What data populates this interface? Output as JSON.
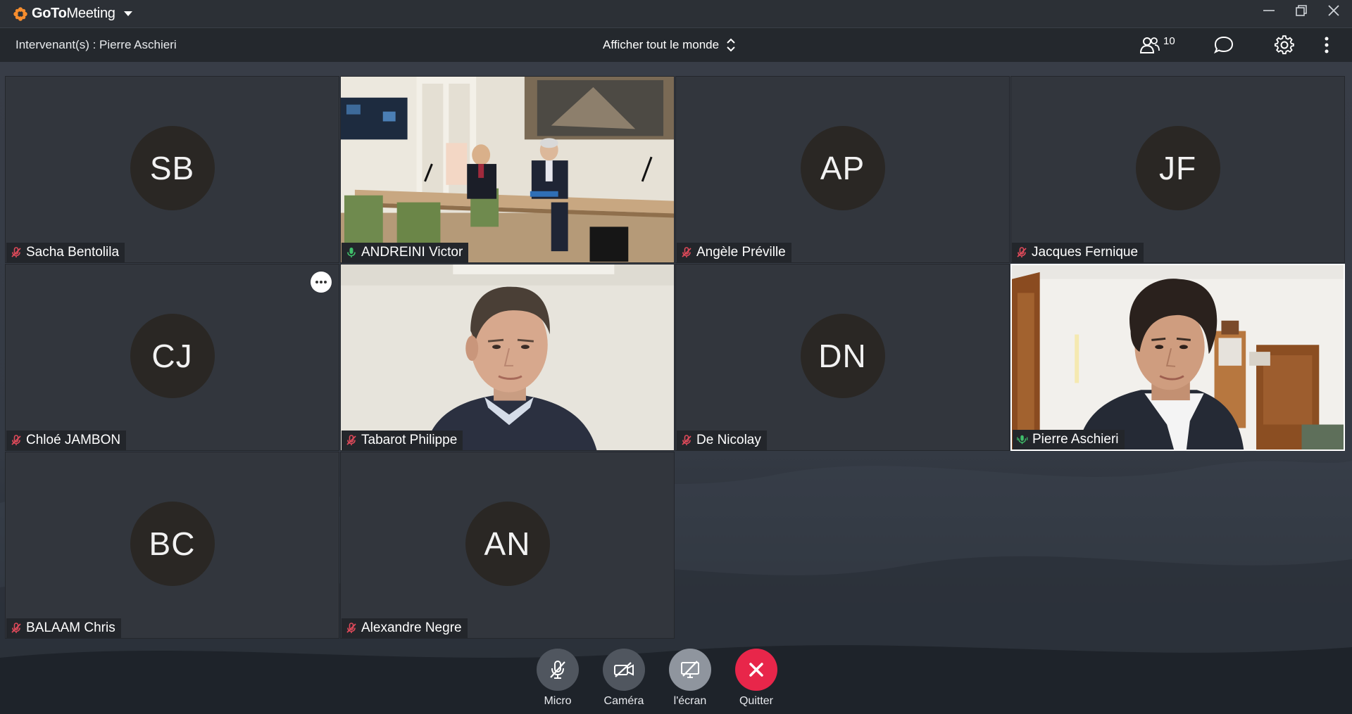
{
  "app": {
    "brand_bold": "GoTo",
    "brand_light": "Meeting"
  },
  "toolbar": {
    "speaker_label": "Intervenant(s) : Pierre Aschieri",
    "view_selector": "Afficher tout le monde",
    "participants_count": "10"
  },
  "participants": [
    {
      "name": "Sacha Bentolila",
      "initials": "SB",
      "mic": "muted"
    },
    {
      "name": "ANDREINI Victor",
      "initials": "",
      "mic": "active",
      "video": true
    },
    {
      "name": "Angèle Préville",
      "initials": "AP",
      "mic": "muted"
    },
    {
      "name": "Jacques Fernique",
      "initials": "JF",
      "mic": "muted"
    },
    {
      "name": "Chloé JAMBON",
      "initials": "CJ",
      "mic": "muted"
    },
    {
      "name": "Tabarot Philippe",
      "initials": "",
      "mic": "muted",
      "video": true
    },
    {
      "name": "De Nicolay",
      "initials": "DN",
      "mic": "muted"
    },
    {
      "name": "Pierre Aschieri",
      "initials": "",
      "mic": "speaking",
      "video": true
    },
    {
      "name": "BALAAM Chris",
      "initials": "BC",
      "mic": "muted"
    },
    {
      "name": "Alexandre Negre",
      "initials": "AN",
      "mic": "muted"
    }
  ],
  "controls": {
    "micro": "Micro",
    "camera": "Caméra",
    "screen": "l'écran",
    "quit": "Quitter"
  },
  "colors": {
    "muted_mic": "#e04a5a",
    "active_mic": "#3fbf6a",
    "quit_button": "#e8264a",
    "brand_orange": "#f68d2e",
    "avatar_bg": "#2a2724"
  }
}
